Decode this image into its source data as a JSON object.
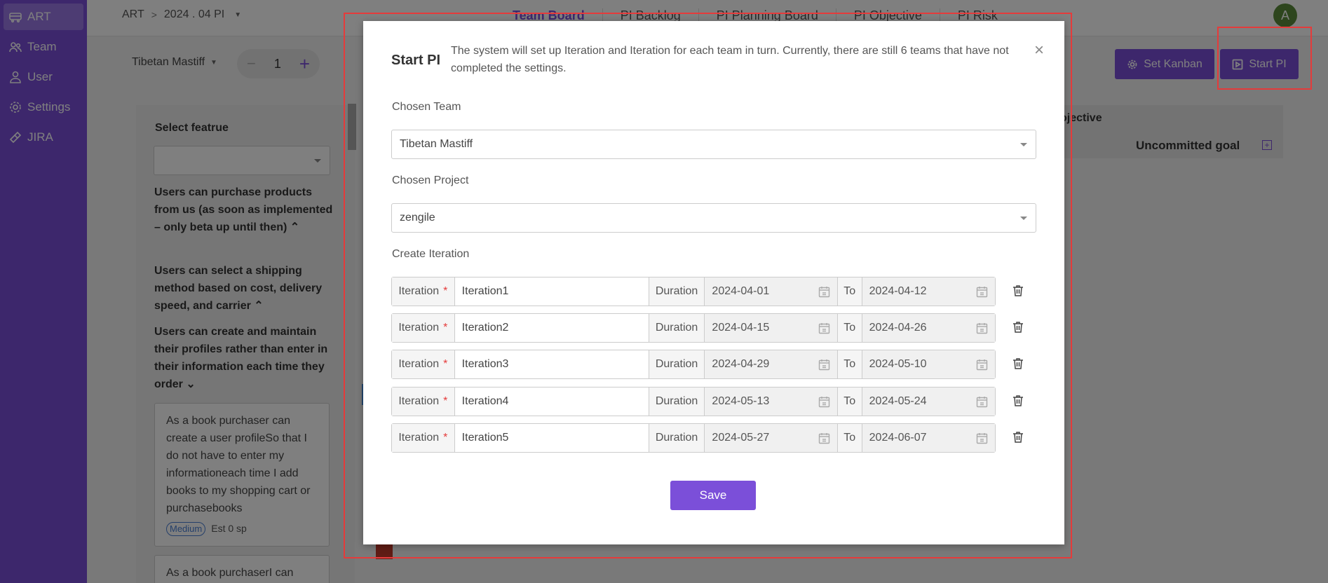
{
  "sidebar": {
    "items": [
      {
        "label": "ART",
        "icon": "train-icon"
      },
      {
        "label": "Team",
        "icon": "team-icon"
      },
      {
        "label": "User",
        "icon": "user-icon"
      },
      {
        "label": "Settings",
        "icon": "gear-icon"
      },
      {
        "label": "JIRA",
        "icon": "jira-icon"
      }
    ]
  },
  "header": {
    "breadcrumb": [
      "ART",
      ">",
      "2024 . 04 PI"
    ],
    "tabs": [
      "Team Board",
      "PI Backlog",
      "PI Planning Board",
      "PI Objective",
      "PI Risk"
    ],
    "active_tab": "Team Board",
    "avatar_letter": "A"
  },
  "toolbar": {
    "team": "Tibetan Mastiff",
    "stepper_minus": "−",
    "stepper_value": "1",
    "stepper_plus": "+",
    "set_kanban": "Set Kanban",
    "start_pi": "Start PI"
  },
  "left_panel": {
    "title": "Select featrue",
    "features": [
      "Users can purchase products from us (as soon as implemented – only beta up until then)",
      "Users can select a shipping method based on cost, delivery speed, and carrier",
      "Users can create and maintain their profiles rather than enter in their information each time they order"
    ],
    "cards": [
      {
        "text": "As a book purchaser can create a user profileSo that I do not have to enter my informationeach time I add books to my shopping cart or purchasebooks",
        "priority": "Medium",
        "estimate": "Est 0 sp"
      },
      {
        "text": "As a book purchaserI can"
      }
    ]
  },
  "board": {
    "header_partial": "ojective",
    "uncommitted": "Uncommitted goal",
    "plus": "+"
  },
  "modal": {
    "title": "Start PI",
    "description": "The system will set up Iteration and Iteration for each team in turn. Currently, there are still 6 teams that have not completed the settings.",
    "close": "×",
    "chosen_team_label": "Chosen Team",
    "chosen_team_value": "Tibetan Mastiff",
    "chosen_project_label": "Chosen Project",
    "chosen_project_value": "zengile",
    "create_iteration_label": "Create Iteration",
    "iteration_label": "Iteration",
    "required_mark": "*",
    "duration_label": "Duration",
    "to_label": "To",
    "iterations": [
      {
        "name": "Iteration1",
        "start": "2024-04-01",
        "end": "2024-04-12"
      },
      {
        "name": "Iteration2",
        "start": "2024-04-15",
        "end": "2024-04-26"
      },
      {
        "name": "Iteration3",
        "start": "2024-04-29",
        "end": "2024-05-10"
      },
      {
        "name": "Iteration4",
        "start": "2024-05-13",
        "end": "2024-05-24"
      },
      {
        "name": "Iteration5",
        "start": "2024-05-27",
        "end": "2024-06-07"
      }
    ],
    "save": "Save"
  },
  "colors": {
    "accent": "#7b4fd9",
    "highlight": "#e53b3b"
  }
}
